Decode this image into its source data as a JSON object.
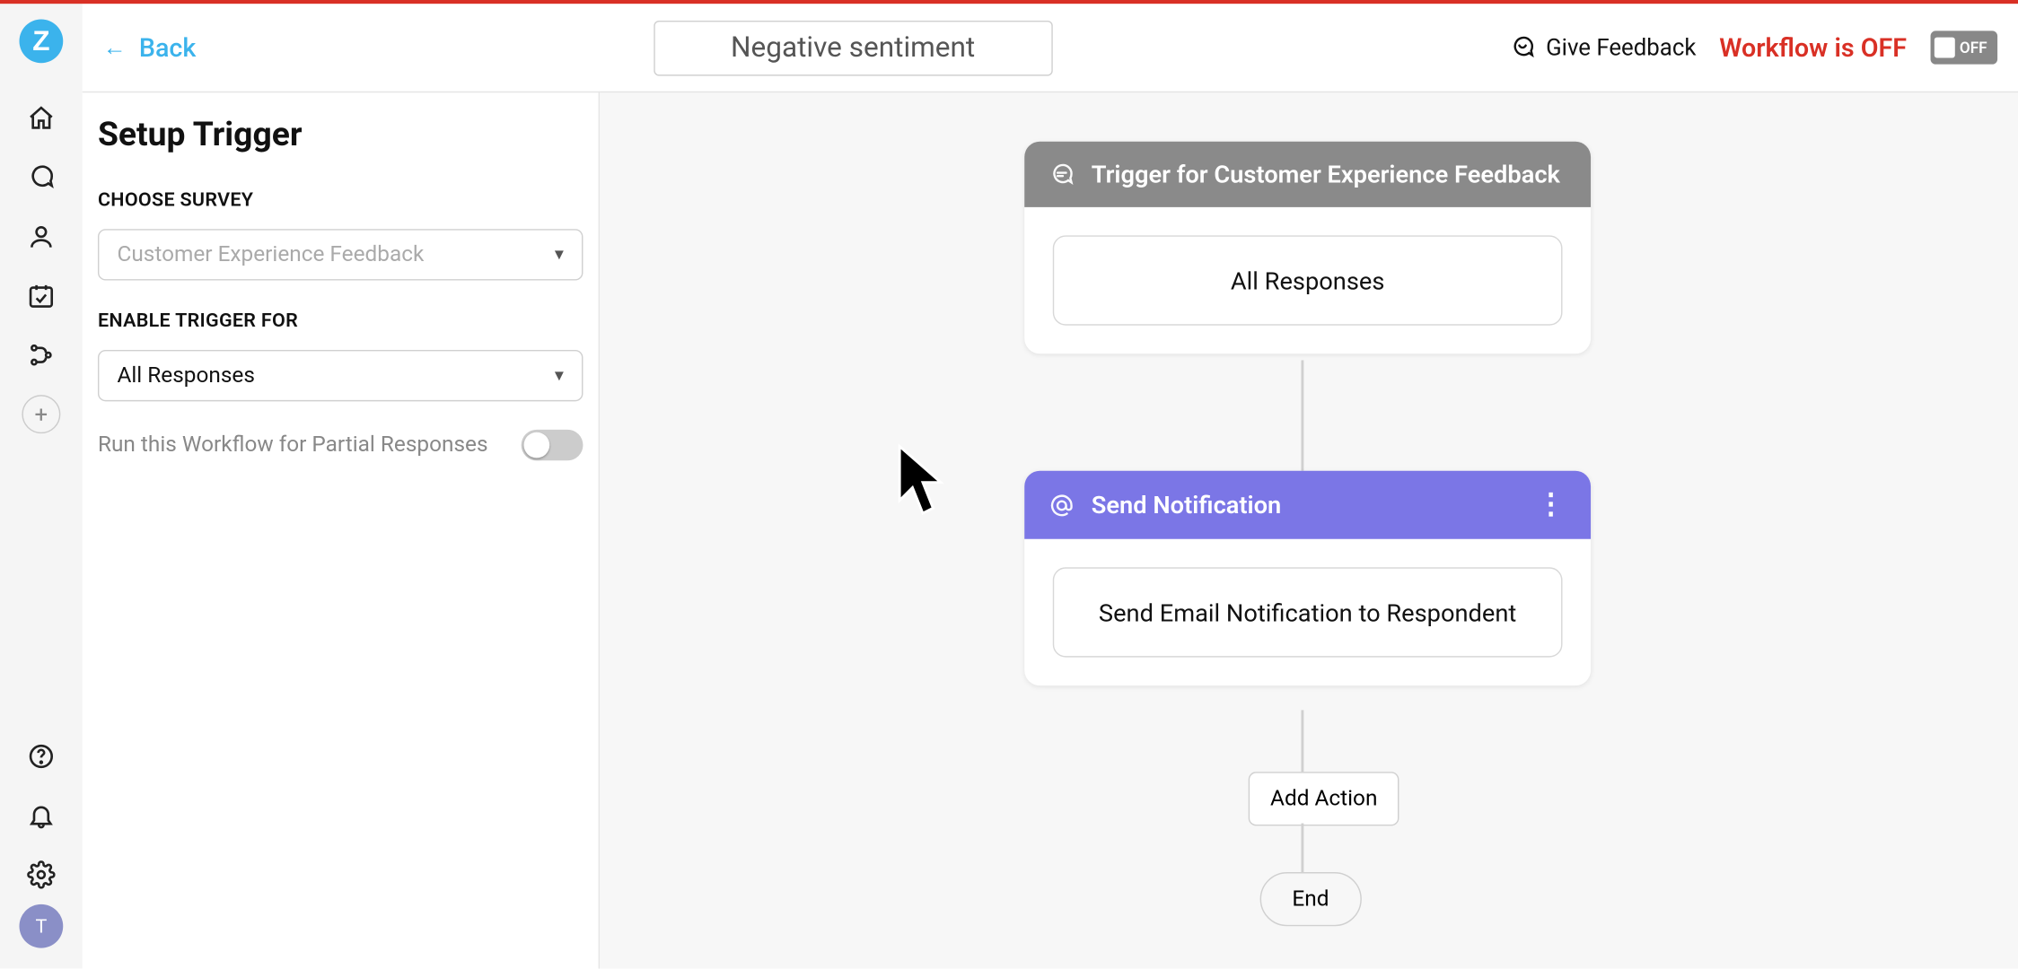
{
  "header": {
    "back_label": "Back",
    "workflow_title": "Negative sentiment",
    "feedback_label": "Give Feedback",
    "status_label": "Workflow is OFF",
    "toggle_label": "OFF"
  },
  "sidebar": {
    "logo_letter": "Z",
    "avatar_letter": "T"
  },
  "sidepanel": {
    "heading": "Setup Trigger",
    "choose_survey_label": "CHOOSE SURVEY",
    "survey_value": "Customer Experience Feedback",
    "enable_trigger_label": "ENABLE TRIGGER FOR",
    "enable_trigger_value": "All Responses",
    "partial_label": "Run this Workflow for Partial Responses"
  },
  "canvas": {
    "trigger": {
      "title": "Trigger for Customer Experience Feedback",
      "body": "All Responses"
    },
    "action": {
      "title": "Send Notification",
      "body": "Send Email Notification to Respondent"
    },
    "add_action_label": "Add Action",
    "end_label": "End"
  }
}
